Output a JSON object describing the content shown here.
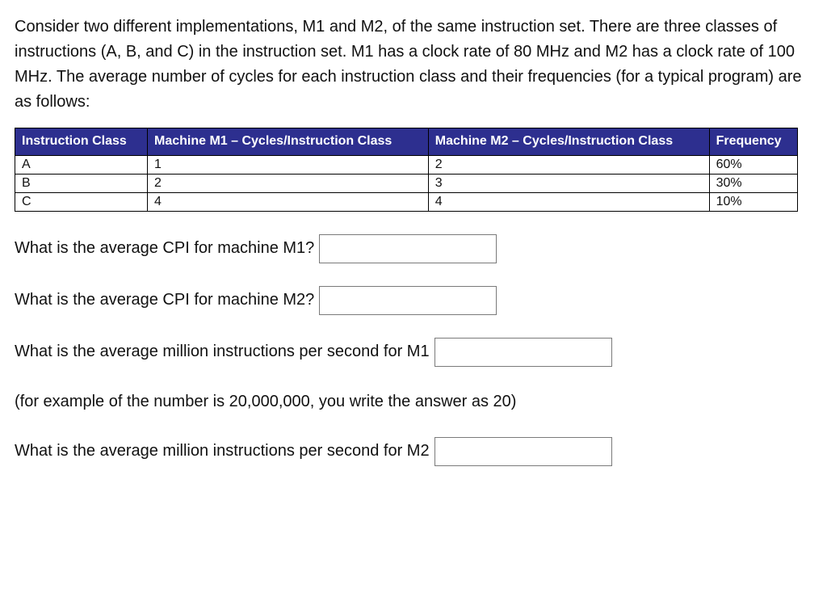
{
  "intro": "Consider two different implementations, M1 and M2, of the same instruction set. There are three classes of instructions (A, B, and C) in the instruction set. M1 has a clock rate of 80 MHz and M2 has a clock rate of 100 MHz. The average number of cycles for each instruction class and their frequencies (for a typical program) are as follows:",
  "table": {
    "headers": {
      "instruction_class": "Instruction Class",
      "m1": "Machine M1 – Cycles/Instruction Class",
      "m2": "Machine M2 – Cycles/Instruction Class",
      "frequency": "Frequency"
    },
    "rows": [
      {
        "ic": "A",
        "m1": "1",
        "m2": "2",
        "freq": "60%"
      },
      {
        "ic": "B",
        "m1": "2",
        "m2": "3",
        "freq": "30%"
      },
      {
        "ic": "C",
        "m1": "4",
        "m2": "4",
        "freq": "10%"
      }
    ]
  },
  "questions": {
    "q1": "What is the average CPI for machine M1?",
    "q2": "What is the average CPI for machine M2?",
    "q3": "What is the average million instructions per second for M1",
    "note": "(for example of the number is 20,000,000, you write the answer as 20)",
    "q4": "What is the average million instructions per second for M2"
  },
  "chart_data": {
    "type": "table",
    "title": "Cycles per instruction class and frequency for machines M1 and M2",
    "columns": [
      "Instruction Class",
      "Machine M1 – Cycles/Instruction Class",
      "Machine M2 – Cycles/Instruction Class",
      "Frequency"
    ],
    "rows": [
      [
        "A",
        1,
        2,
        "60%"
      ],
      [
        "B",
        2,
        3,
        "30%"
      ],
      [
        "C",
        4,
        4,
        "10%"
      ]
    ]
  }
}
